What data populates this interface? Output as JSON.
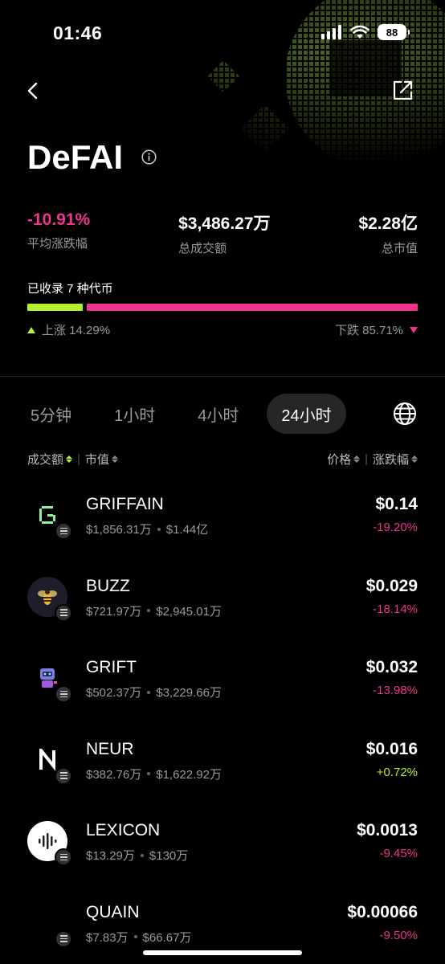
{
  "status_bar": {
    "time": "01:46",
    "battery": "88"
  },
  "header": {
    "title": "DeFAI"
  },
  "stats": {
    "avg_change": {
      "value": "-10.91%",
      "label": "平均涨跌幅"
    },
    "volume": {
      "value": "$3,486.27万",
      "label": "总成交额"
    },
    "market_cap": {
      "value": "$2.28亿",
      "label": "总市值"
    }
  },
  "collected": "已收录 7 种代币",
  "distribution": {
    "up_fraction": 0.1429,
    "up_label": "上涨 14.29%",
    "down_label": "下跌 85.71%",
    "up_color": "#b4f02f",
    "down_color": "#f0338b"
  },
  "tabs": [
    {
      "label": "5分钟",
      "active": false
    },
    {
      "label": "1小时",
      "active": false
    },
    {
      "label": "4小时",
      "active": false
    },
    {
      "label": "24小时",
      "active": true
    }
  ],
  "sort": {
    "volume": "成交额",
    "market_cap": "市值",
    "price": "价格",
    "change": "涨跌幅"
  },
  "tokens": [
    {
      "name": "GRIFFAIN",
      "volume": "$1,856.31万",
      "market_cap": "$1.44亿",
      "price": "$0.14",
      "change": "-19.20%",
      "direction": "down",
      "icon": "griffain-logo"
    },
    {
      "name": "BUZZ",
      "volume": "$721.97万",
      "market_cap": "$2,945.01万",
      "price": "$0.029",
      "change": "-18.14%",
      "direction": "down",
      "icon": "bee-logo"
    },
    {
      "name": "GRIFT",
      "volume": "$502.37万",
      "market_cap": "$3,229.66万",
      "price": "$0.032",
      "change": "-13.98%",
      "direction": "down",
      "icon": "robot-logo"
    },
    {
      "name": "NEUR",
      "volume": "$382.76万",
      "market_cap": "$1,622.92万",
      "price": "$0.016",
      "change": "+0.72%",
      "direction": "up",
      "icon": "neur-logo"
    },
    {
      "name": "LEXICON",
      "volume": "$13.29万",
      "market_cap": "$130万",
      "price": "$0.0013",
      "change": "-9.45%",
      "direction": "down",
      "icon": "soundwave-logo"
    },
    {
      "name": "QUAIN",
      "volume": "$7.83万",
      "market_cap": "$66.67万",
      "price": "$0.00066",
      "change": "-9.50%",
      "direction": "down",
      "icon": "quain-logo"
    }
  ]
}
